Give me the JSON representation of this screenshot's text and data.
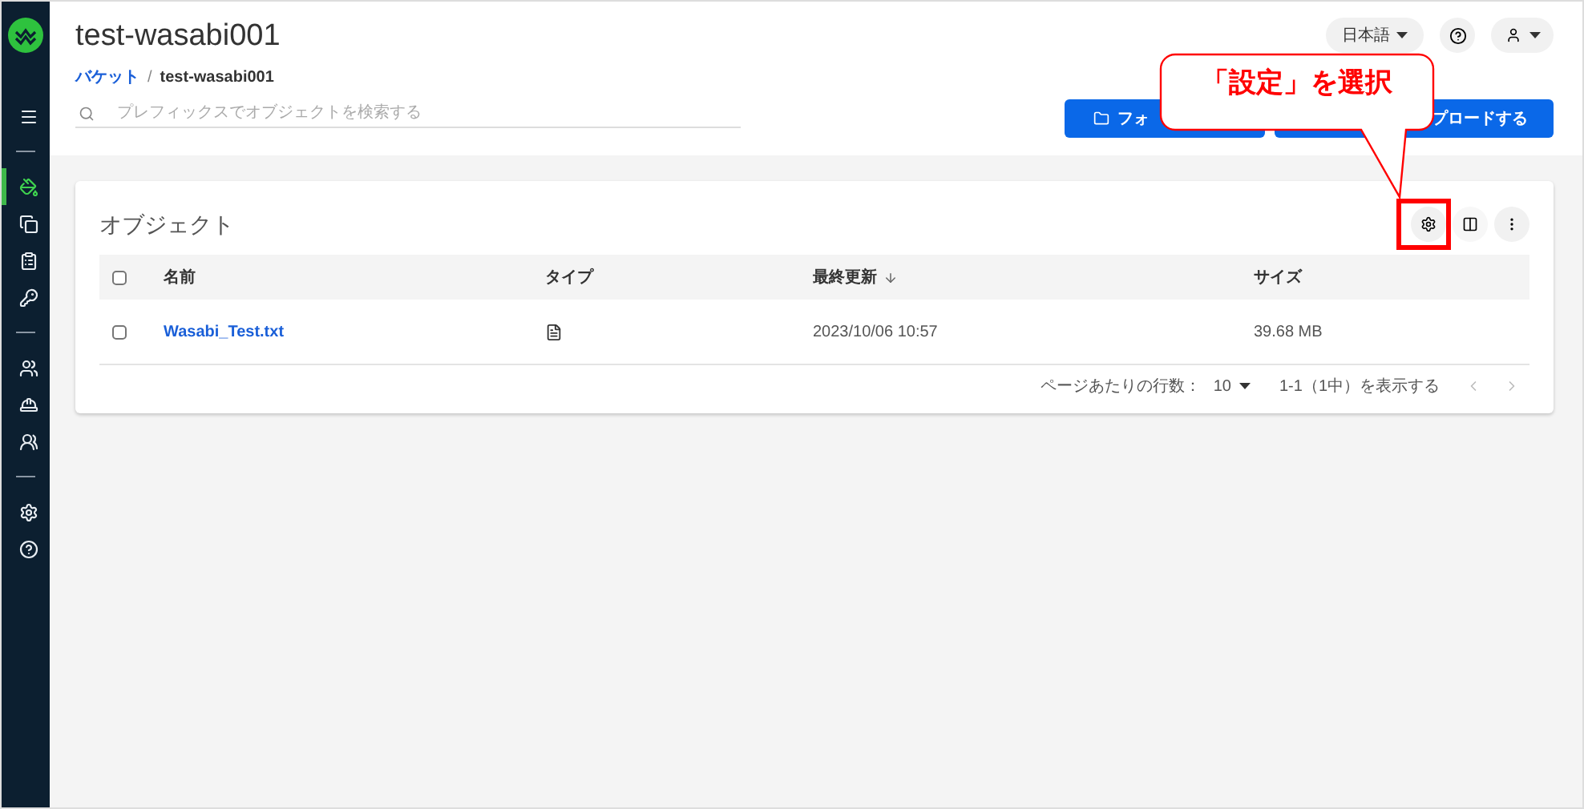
{
  "sidebar": {
    "sections": [
      {
        "items": [
          {
            "kind": "menu",
            "selected": false
          }
        ]
      },
      {
        "items": [
          {
            "kind": "bucket",
            "selected": true
          },
          {
            "kind": "copy",
            "selected": false
          },
          {
            "kind": "clipboard",
            "selected": false
          },
          {
            "kind": "key",
            "selected": false
          }
        ]
      },
      {
        "items": [
          {
            "kind": "group",
            "selected": false
          },
          {
            "kind": "hat",
            "selected": false
          },
          {
            "kind": "users",
            "selected": false
          }
        ]
      },
      {
        "items": [
          {
            "kind": "settings",
            "selected": false
          },
          {
            "kind": "help",
            "selected": false
          }
        ]
      }
    ]
  },
  "header": {
    "title": "test-wasabi001",
    "breadcrumb": [
      {
        "label": "バケット",
        "kind": "link"
      },
      {
        "label": "/",
        "kind": "separator"
      },
      {
        "label": "test-wasabi001",
        "kind": "current"
      }
    ],
    "search": {
      "placeholder": "プレフィックスでオブジェクトを検索する"
    },
    "language": "日本語",
    "buttons": [
      {
        "label": "フォ",
        "kind": "folder"
      },
      {
        "label": "プロードする",
        "kind": "upload"
      }
    ]
  },
  "objects": {
    "title": "オブジェクト",
    "columns": [
      "名前",
      "タイプ",
      "最終更新",
      "サイズ"
    ],
    "rows": [
      {
        "name": "Wasabi_Test.txt",
        "checked": false,
        "modified": "2023/10/06 10:57",
        "size": "39.68 MB"
      }
    ],
    "header_checked": false,
    "pagination": {
      "rows_label": "ページあたりの行数：",
      "rows_value": "10",
      "range": "1-1（1中）を表示する"
    }
  },
  "callout": {
    "text": "「設定」を選択"
  }
}
